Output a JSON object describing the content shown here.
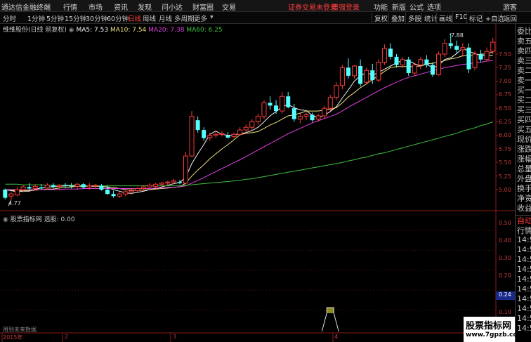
{
  "topbar": {
    "app_title": "通达信金融终端",
    "menus": [
      "行情",
      "市场",
      "资讯",
      "发现",
      "问小达",
      "财富圈",
      "交易"
    ],
    "notice": "证券交易未登录",
    "login": "增强登录",
    "right_menus": [
      "功能",
      "新版",
      "公式",
      "选项"
    ],
    "guest": "游客"
  },
  "toolbar": {
    "periods": [
      "分时",
      "1分钟",
      "5分钟",
      "15分钟",
      "30分钟",
      "60分钟",
      "日线",
      "周线",
      "月线",
      "多周期",
      "更多"
    ],
    "active_period": "日线",
    "right_buttons": [
      "复权",
      "叠加",
      "多股",
      "统计",
      "画线",
      "F10",
      "标记",
      "+自选",
      "返回"
    ]
  },
  "main_legend": {
    "stock": "维维股份(日线 前复权)",
    "ma5": "MA5: 7.53",
    "ma10": "MA10: 7.54",
    "ma20": "MA20: 7.38",
    "ma60": "MA60: 6.25"
  },
  "indicator_legend": {
    "name": "股票指标网",
    "value": "选股: 0.00"
  },
  "price_axis": [
    "7.50",
    "7.25",
    "7.00",
    "6.75",
    "6.50",
    "6.25",
    "6.00",
    "5.75",
    "5.50",
    "5.25",
    "5.00"
  ],
  "indicator_axis": [
    "0.50",
    "0.40",
    "0.30",
    "0.20",
    "0.10"
  ],
  "indicator_current": "0.24",
  "annotations": {
    "high": "7.88",
    "low": "4.77"
  },
  "x_axis": [
    "2015年",
    "2",
    "3",
    "4"
  ],
  "bottom_left": "用到未来数据",
  "right_panel": [
    "委比",
    "卖五",
    "卖四",
    "卖三",
    "卖二",
    "卖一",
    "买一",
    "买二",
    "买三",
    "买四",
    "买五",
    "现价",
    "涨跌",
    "涨幅",
    "总量",
    "外盘",
    "换手",
    "净资",
    "收益",
    "",
    "自动",
    "行情",
    "14:5",
    "14:5",
    "14:5",
    "14:5",
    "14:5",
    "14:5",
    "14:5",
    "14:5",
    "14:5",
    "14:5"
  ],
  "watermark": {
    "line1": "股票指标网",
    "line2": "www.7gpzb.com"
  },
  "chart_data": {
    "type": "candlestick",
    "y_range": [
      4.7,
      8.0
    ],
    "ohlc": [
      [
        5.0,
        5.02,
        4.82,
        4.85
      ],
      [
        4.88,
        4.95,
        4.8,
        4.92
      ],
      [
        4.9,
        5.05,
        4.88,
        5.0
      ],
      [
        5.0,
        5.08,
        4.95,
        5.05
      ],
      [
        5.05,
        5.12,
        4.98,
        5.02
      ],
      [
        5.02,
        5.1,
        4.98,
        5.06
      ],
      [
        5.04,
        5.1,
        5.0,
        5.02
      ],
      [
        5.03,
        5.12,
        5.0,
        5.08
      ],
      [
        5.08,
        5.12,
        5.02,
        5.05
      ],
      [
        5.06,
        5.1,
        5.0,
        5.08
      ],
      [
        5.08,
        5.12,
        5.03,
        5.07
      ],
      [
        5.07,
        5.12,
        5.02,
        5.06
      ],
      [
        5.06,
        5.12,
        5.0,
        5.1
      ],
      [
        5.1,
        5.12,
        5.02,
        5.04
      ],
      [
        5.05,
        5.12,
        5.0,
        5.07
      ],
      [
        5.07,
        5.1,
        5.02,
        5.08
      ],
      [
        5.07,
        5.1,
        4.98,
        5.0
      ],
      [
        5.0,
        5.08,
        4.9,
        4.92
      ],
      [
        4.92,
        4.98,
        4.85,
        4.88
      ],
      [
        4.88,
        4.95,
        4.85,
        4.92
      ],
      [
        4.92,
        5.0,
        4.88,
        4.96
      ],
      [
        4.96,
        5.02,
        4.9,
        4.98
      ],
      [
        4.98,
        5.05,
        4.95,
        5.02
      ],
      [
        5.02,
        5.08,
        4.98,
        5.05
      ],
      [
        5.05,
        5.12,
        5.02,
        5.08
      ],
      [
        5.06,
        5.12,
        5.02,
        5.1
      ],
      [
        5.1,
        5.14,
        5.05,
        5.12
      ],
      [
        5.12,
        5.16,
        5.08,
        5.14
      ],
      [
        5.14,
        5.2,
        5.1,
        5.16
      ],
      [
        5.14,
        5.18,
        5.1,
        5.12
      ],
      [
        5.12,
        5.7,
        5.1,
        5.62
      ],
      [
        5.62,
        6.45,
        5.6,
        6.35
      ],
      [
        6.28,
        6.35,
        6.05,
        6.1
      ],
      [
        6.1,
        6.15,
        5.9,
        5.95
      ],
      [
        5.96,
        6.05,
        5.9,
        6.0
      ],
      [
        6.0,
        6.08,
        5.95,
        6.02
      ],
      [
        6.02,
        6.08,
        5.98,
        6.03
      ],
      [
        6.0,
        6.06,
        5.94,
        5.96
      ],
      [
        5.98,
        6.05,
        5.95,
        6.02
      ],
      [
        6.02,
        6.15,
        6.0,
        6.1
      ],
      [
        6.1,
        6.2,
        6.05,
        6.15
      ],
      [
        6.15,
        6.3,
        6.1,
        6.25
      ],
      [
        6.25,
        6.4,
        6.2,
        6.35
      ],
      [
        6.35,
        6.65,
        6.3,
        6.6
      ],
      [
        6.6,
        6.72,
        6.48,
        6.55
      ],
      [
        6.55,
        6.65,
        6.4,
        6.45
      ],
      [
        6.45,
        6.8,
        6.4,
        6.72
      ],
      [
        6.72,
        6.8,
        6.5,
        6.52
      ],
      [
        6.5,
        6.58,
        6.25,
        6.3
      ],
      [
        6.3,
        6.4,
        6.22,
        6.35
      ],
      [
        6.35,
        6.42,
        6.28,
        6.38
      ],
      [
        6.38,
        6.42,
        6.25,
        6.28
      ],
      [
        6.3,
        6.4,
        6.25,
        6.36
      ],
      [
        6.36,
        6.55,
        6.32,
        6.5
      ],
      [
        6.5,
        6.75,
        6.45,
        6.7
      ],
      [
        6.7,
        6.98,
        6.65,
        6.92
      ],
      [
        6.92,
        7.3,
        6.85,
        7.25
      ],
      [
        7.25,
        7.42,
        7.05,
        7.1
      ],
      [
        7.1,
        7.3,
        7.05,
        7.28
      ],
      [
        7.28,
        7.4,
        6.9,
        6.95
      ],
      [
        6.98,
        7.25,
        6.95,
        7.2
      ],
      [
        7.2,
        7.32,
        6.95,
        7.02
      ],
      [
        7.02,
        7.4,
        6.98,
        7.35
      ],
      [
        7.35,
        7.68,
        7.3,
        7.6
      ],
      [
        7.6,
        7.7,
        7.4,
        7.45
      ],
      [
        7.45,
        7.5,
        7.25,
        7.3
      ],
      [
        7.3,
        7.45,
        7.25,
        7.4
      ],
      [
        7.4,
        7.45,
        7.1,
        7.15
      ],
      [
        7.15,
        7.35,
        7.1,
        7.3
      ],
      [
        7.3,
        7.45,
        7.22,
        7.4
      ],
      [
        7.4,
        7.48,
        7.25,
        7.3
      ],
      [
        7.3,
        7.35,
        7.08,
        7.12
      ],
      [
        7.12,
        7.55,
        7.1,
        7.5
      ],
      [
        7.5,
        7.78,
        7.45,
        7.7
      ],
      [
        7.7,
        7.88,
        7.6,
        7.65
      ],
      [
        7.65,
        7.75,
        7.5,
        7.58
      ],
      [
        7.58,
        7.7,
        7.45,
        7.62
      ],
      [
        7.62,
        7.7,
        7.15,
        7.22
      ],
      [
        7.25,
        7.55,
        7.2,
        7.5
      ],
      [
        7.5,
        7.58,
        7.35,
        7.4
      ],
      [
        7.4,
        7.62,
        7.38,
        7.55
      ],
      [
        7.55,
        7.8,
        7.5,
        7.72
      ]
    ],
    "ma_series": [
      {
        "name": "MA5",
        "color": "#f5f5f5",
        "values": [
          5.0,
          4.98,
          4.96,
          4.97,
          4.97,
          5.01,
          5.03,
          5.05,
          5.05,
          5.06,
          5.07,
          5.07,
          5.07,
          5.07,
          5.07,
          5.07,
          5.06,
          5.04,
          5.0,
          4.97,
          4.94,
          4.93,
          4.95,
          4.97,
          5.0,
          5.02,
          5.05,
          5.08,
          5.11,
          5.13,
          5.23,
          5.48,
          5.66,
          5.83,
          6.02,
          6.08,
          6.02,
          6.0,
          6.01,
          6.03,
          6.05,
          6.09,
          6.15,
          6.25,
          6.36,
          6.44,
          6.53,
          6.57,
          6.51,
          6.47,
          6.46,
          6.37,
          6.33,
          6.37,
          6.44,
          6.53,
          6.69,
          6.84,
          7.0,
          7.1,
          7.16,
          7.11,
          7.16,
          7.22,
          7.28,
          7.34,
          7.38,
          7.38,
          7.32,
          7.28,
          7.31,
          7.25,
          7.29,
          7.4,
          7.43,
          7.51,
          7.61,
          7.55,
          7.51,
          7.48,
          7.46,
          7.48
        ]
      },
      {
        "name": "MA10",
        "color": "#f0e080",
        "values": [
          5.0,
          4.99,
          4.98,
          4.98,
          4.98,
          4.99,
          5.0,
          5.01,
          5.01,
          5.03,
          5.04,
          5.05,
          5.06,
          5.06,
          5.06,
          5.06,
          5.06,
          5.05,
          5.04,
          5.02,
          5.0,
          4.99,
          4.99,
          4.99,
          5.0,
          5.01,
          5.02,
          5.03,
          5.04,
          5.05,
          5.12,
          5.25,
          5.36,
          5.46,
          5.57,
          5.66,
          5.75,
          5.83,
          5.92,
          6.01,
          6.04,
          6.05,
          6.07,
          6.13,
          6.19,
          6.24,
          6.3,
          6.36,
          6.38,
          6.41,
          6.45,
          6.45,
          6.45,
          6.47,
          6.48,
          6.51,
          6.6,
          6.71,
          6.79,
          6.88,
          6.95,
          7.03,
          7.1,
          7.18,
          7.25,
          7.27,
          7.27,
          7.27,
          7.27,
          7.28,
          7.32,
          7.33,
          7.35,
          7.38,
          7.41,
          7.43,
          7.47,
          7.47,
          7.48,
          7.5,
          7.5,
          7.54
        ]
      },
      {
        "name": "MA20",
        "color": "#e040e0",
        "values": [
          5.0,
          5.0,
          5.0,
          5.0,
          5.0,
          5.0,
          5.0,
          5.0,
          5.0,
          5.0,
          5.01,
          5.01,
          5.01,
          5.02,
          5.02,
          5.02,
          5.02,
          5.02,
          5.02,
          5.02,
          5.02,
          5.02,
          5.02,
          5.02,
          5.02,
          5.03,
          5.03,
          5.04,
          5.04,
          5.05,
          5.07,
          5.12,
          5.17,
          5.22,
          5.28,
          5.33,
          5.39,
          5.44,
          5.5,
          5.55,
          5.61,
          5.67,
          5.73,
          5.79,
          5.85,
          5.91,
          5.97,
          6.03,
          6.08,
          6.13,
          6.18,
          6.23,
          6.27,
          6.31,
          6.35,
          6.39,
          6.45,
          6.52,
          6.58,
          6.64,
          6.7,
          6.76,
          6.82,
          6.88,
          6.93,
          6.98,
          7.03,
          7.07,
          7.1,
          7.13,
          7.16,
          7.19,
          7.22,
          7.25,
          7.27,
          7.29,
          7.31,
          7.32,
          7.34,
          7.35,
          7.37,
          7.38
        ]
      },
      {
        "name": "MA60",
        "color": "#40c040",
        "values": [
          5.1,
          5.1,
          5.1,
          5.09,
          5.09,
          5.09,
          5.09,
          5.08,
          5.08,
          5.08,
          5.08,
          5.08,
          5.08,
          5.07,
          5.07,
          5.07,
          5.07,
          5.07,
          5.07,
          5.07,
          5.07,
          5.07,
          5.07,
          5.07,
          5.07,
          5.07,
          5.07,
          5.07,
          5.07,
          5.07,
          5.08,
          5.09,
          5.1,
          5.11,
          5.12,
          5.13,
          5.14,
          5.15,
          5.16,
          5.17,
          5.19,
          5.2,
          5.22,
          5.24,
          5.26,
          5.28,
          5.3,
          5.32,
          5.34,
          5.36,
          5.38,
          5.4,
          5.42,
          5.44,
          5.46,
          5.48,
          5.5,
          5.53,
          5.55,
          5.58,
          5.6,
          5.63,
          5.66,
          5.68,
          5.71,
          5.74,
          5.77,
          5.8,
          5.83,
          5.86,
          5.89,
          5.92,
          5.95,
          5.98,
          6.01,
          6.04,
          6.08,
          6.11,
          6.14,
          6.18,
          6.21,
          6.25
        ]
      }
    ],
    "indicator": {
      "name": "选股",
      "signal_bar_index": 54,
      "signal_value": 1.0,
      "y_range": [
        0,
        0.55
      ]
    }
  }
}
